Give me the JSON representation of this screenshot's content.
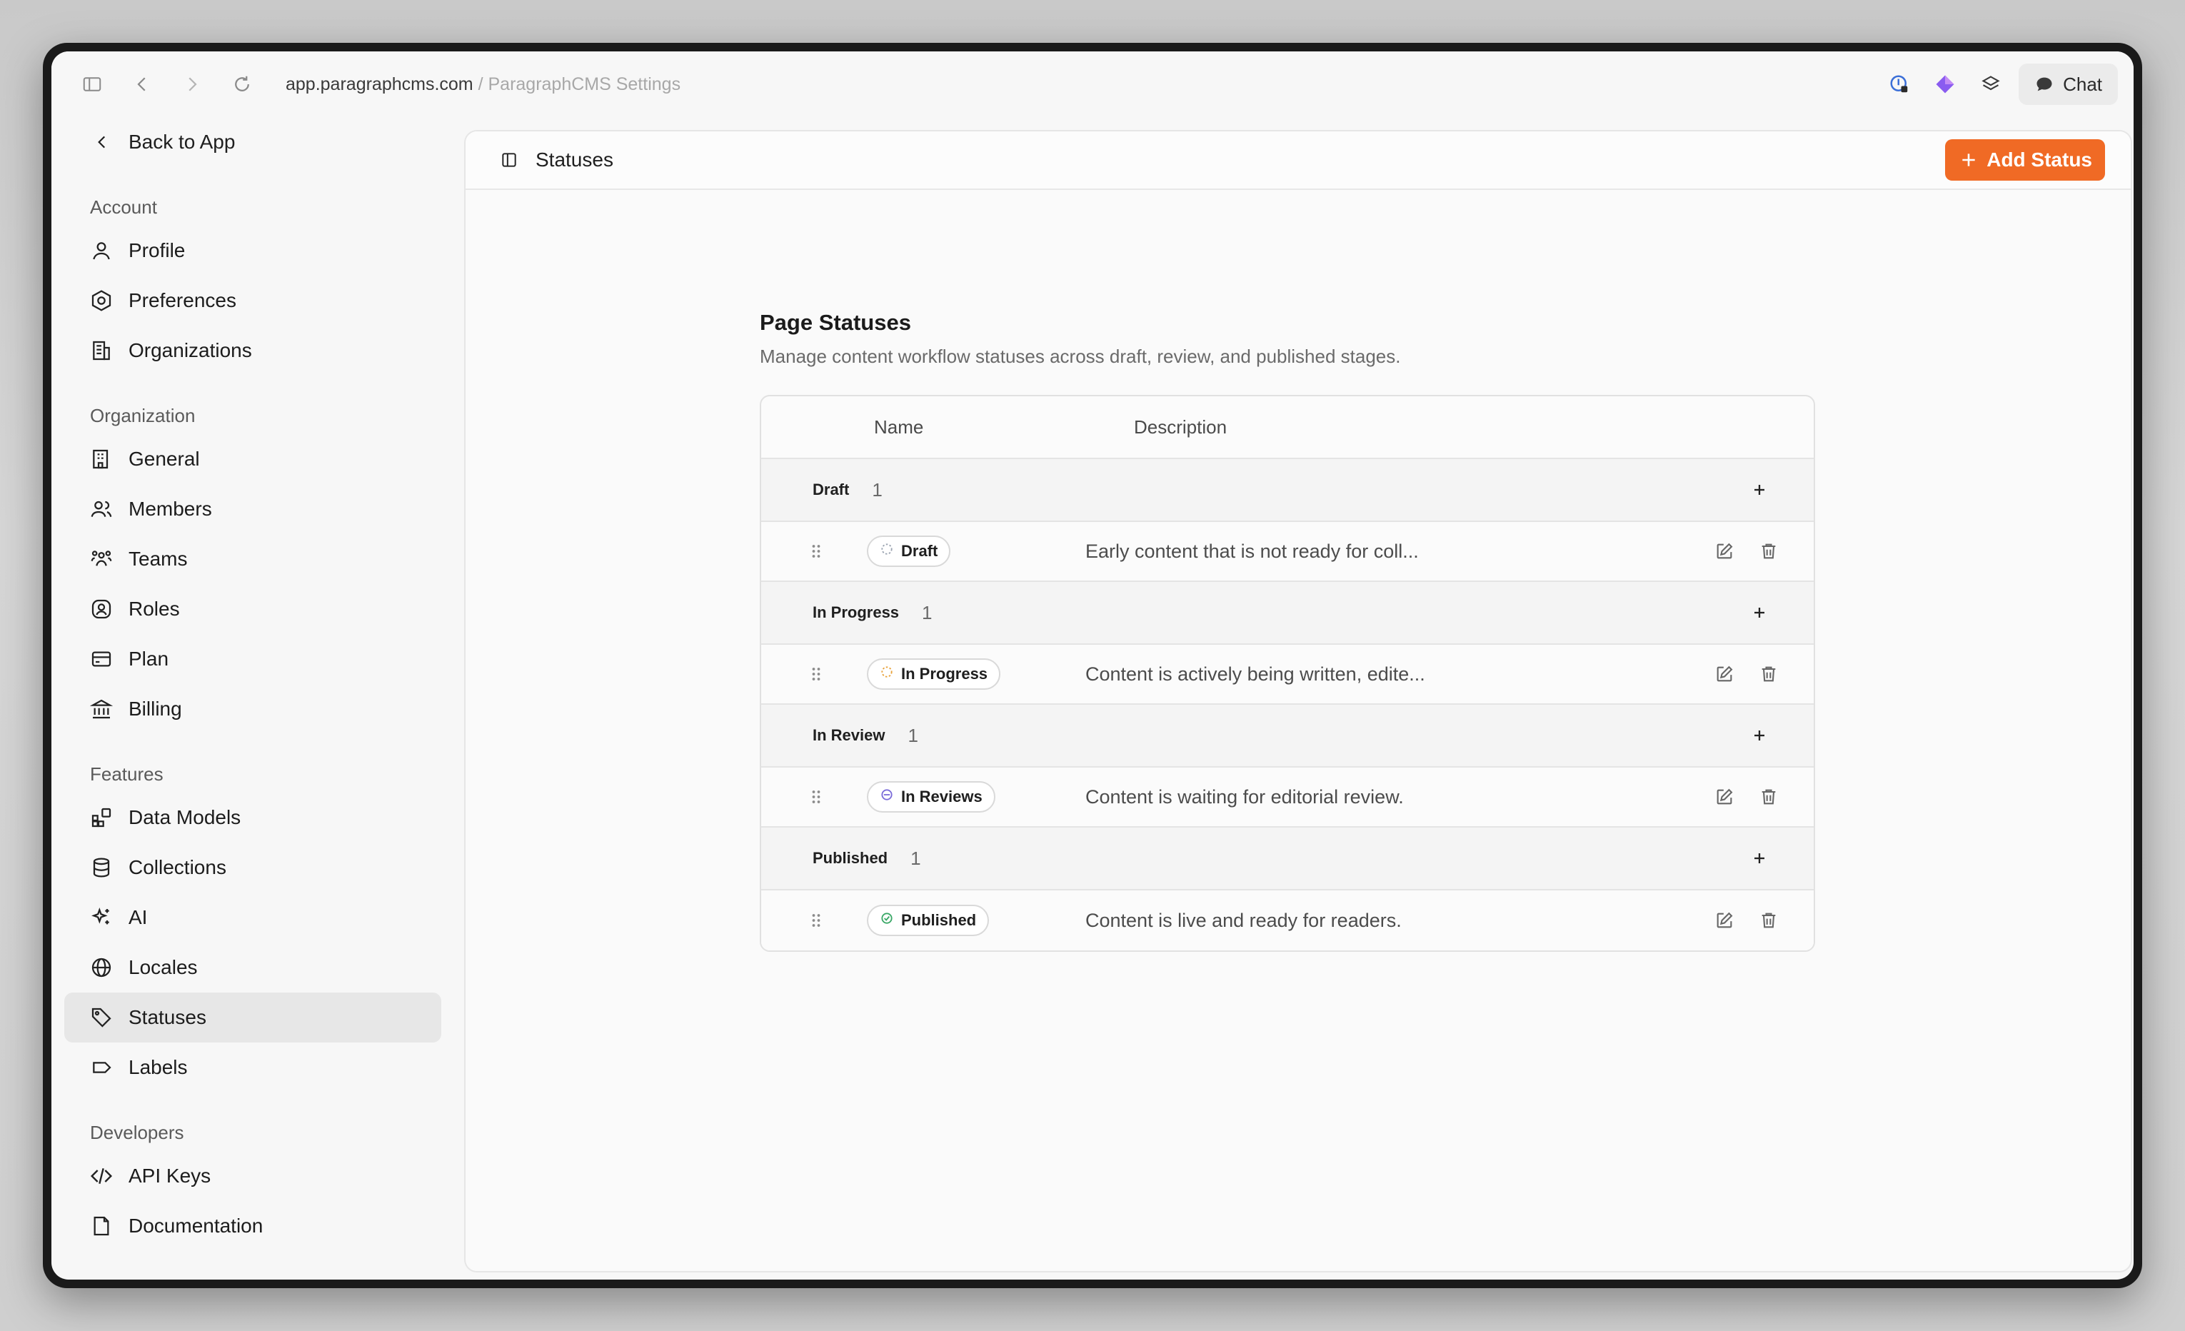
{
  "browser": {
    "url_domain": "app.paragraphcms.com",
    "url_separator": " / ",
    "page_title": "ParagraphCMS Settings",
    "chat_label": "Chat"
  },
  "sidebar": {
    "back_label": "Back to App",
    "groups": [
      {
        "label": "Account",
        "items": [
          {
            "label": "Profile",
            "icon": "user-icon"
          },
          {
            "label": "Preferences",
            "icon": "settings-hex-icon"
          },
          {
            "label": "Organizations",
            "icon": "building-icon"
          }
        ]
      },
      {
        "label": "Organization",
        "items": [
          {
            "label": "General",
            "icon": "building-general-icon"
          },
          {
            "label": "Members",
            "icon": "users-icon"
          },
          {
            "label": "Teams",
            "icon": "teams-icon"
          },
          {
            "label": "Roles",
            "icon": "role-badge-icon"
          },
          {
            "label": "Plan",
            "icon": "card-icon"
          },
          {
            "label": "Billing",
            "icon": "bank-icon"
          }
        ]
      },
      {
        "label": "Features",
        "items": [
          {
            "label": "Data Models",
            "icon": "blocks-icon"
          },
          {
            "label": "Collections",
            "icon": "database-icon"
          },
          {
            "label": "AI",
            "icon": "sparkles-icon"
          },
          {
            "label": "Locales",
            "icon": "globe-icon"
          },
          {
            "label": "Statuses",
            "icon": "tag-icon",
            "active": true
          },
          {
            "label": "Labels",
            "icon": "label-icon"
          }
        ]
      },
      {
        "label": "Developers",
        "items": [
          {
            "label": "API Keys",
            "icon": "code-icon"
          },
          {
            "label": "Documentation",
            "icon": "doc-icon"
          }
        ]
      }
    ]
  },
  "header": {
    "title": "Statuses",
    "add_button": "Add Status",
    "accent": "#f06a25"
  },
  "page": {
    "title": "Page Statuses",
    "subtitle": "Manage content workflow statuses across draft, review, and published stages."
  },
  "table": {
    "columns": {
      "name": "Name",
      "description": "Description"
    },
    "groups": [
      {
        "name": "Draft",
        "count": "1",
        "status": {
          "label": "Draft",
          "color": "#9aa3b0",
          "style": "dashed",
          "description": "Early content that is not ready for coll..."
        }
      },
      {
        "name": "In Progress",
        "count": "1",
        "status": {
          "label": "In Progress",
          "color": "#e8a23b",
          "style": "dashed",
          "description": "Content is actively being written, edite..."
        }
      },
      {
        "name": "In Review",
        "count": "1",
        "status": {
          "label": "In Reviews",
          "color": "#7b6cd9",
          "style": "minus",
          "description": "Content is waiting for editorial review."
        }
      },
      {
        "name": "Published",
        "count": "1",
        "status": {
          "label": "Published",
          "color": "#3aa867",
          "style": "check",
          "description": "Content is live and ready for readers."
        }
      }
    ]
  }
}
